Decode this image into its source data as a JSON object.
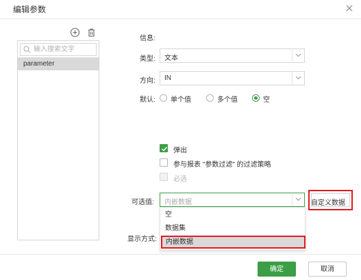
{
  "dialog": {
    "title": "编辑参数"
  },
  "left": {
    "search_placeholder": "输入搜索文字",
    "items": [
      "parameter"
    ]
  },
  "form": {
    "info_label": "信息:",
    "type_label": "类型:",
    "type_value": "文本",
    "direction_label": "方向:",
    "direction_value": "IN",
    "default_label": "默认:",
    "default_options": [
      "单个值",
      "多个值",
      "空"
    ],
    "default_selected": "空",
    "popup_label": "弹出",
    "participate_label": "参与报表 \"参数过滤\" 的过滤策略",
    "required_label": "必选",
    "optional_label": "可选值:",
    "optional_value": "内嵌数据",
    "custom_data_button": "自定义数据",
    "display_label": "显示方式:",
    "dropdown_options": [
      "空",
      "数据集",
      "内嵌数据"
    ]
  },
  "footer": {
    "ok_label": "确定",
    "cancel_label": "取消"
  },
  "colors": {
    "accent": "#3c9f45",
    "highlight_red": "#e0191d"
  }
}
